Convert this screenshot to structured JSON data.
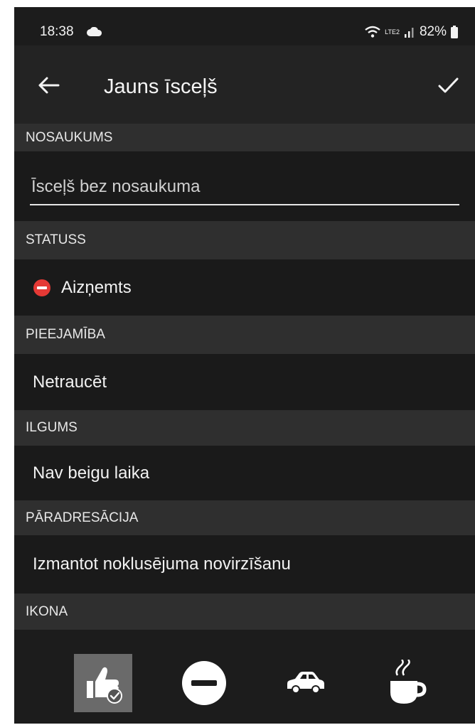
{
  "status_bar": {
    "time": "18:38",
    "signal_text": "LTE2",
    "battery": "82%"
  },
  "app_bar": {
    "title": "Jauns īsceļš"
  },
  "sections": {
    "name": {
      "header": "NOSAUKUMS",
      "placeholder": "Īsceļš bez nosaukuma"
    },
    "status": {
      "header": "STATUSS",
      "value": "Aizņemts",
      "icon": "busy-icon",
      "icon_color": "#e53935"
    },
    "availability": {
      "header": "PIEEJAMĪBA",
      "value": "Netraucēt"
    },
    "duration": {
      "header": "ILGUMS",
      "value": "Nav beigu laika"
    },
    "forwarding": {
      "header": "PĀRADRESĀCIJA",
      "value": "Izmantot noklusējuma novirzīšanu"
    },
    "icon": {
      "header": "IKONA",
      "options": [
        {
          "name": "thumbs-up-icon",
          "selected": true
        },
        {
          "name": "minus-circle-icon",
          "selected": false
        },
        {
          "name": "car-icon",
          "selected": false
        },
        {
          "name": "coffee-icon",
          "selected": false
        }
      ]
    }
  }
}
